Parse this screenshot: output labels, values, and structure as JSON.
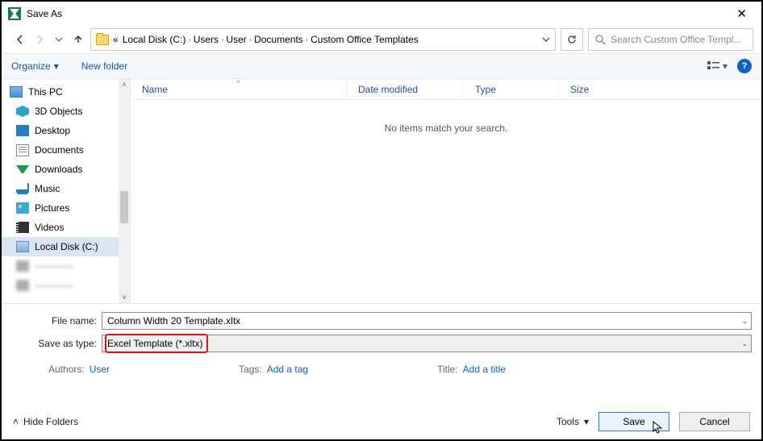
{
  "window": {
    "title": "Save As"
  },
  "address": {
    "prefix": "«",
    "crumbs": [
      "Local Disk (C:)",
      "Users",
      "User",
      "Documents",
      "Custom Office Templates"
    ],
    "search_placeholder": "Search Custom Office Templ..."
  },
  "toolbar": {
    "organize": "Organize",
    "newfolder": "New folder"
  },
  "tree": {
    "root": "This PC",
    "items": [
      "3D Objects",
      "Desktop",
      "Documents",
      "Downloads",
      "Music",
      "Pictures",
      "Videos",
      "Local Disk (C:)"
    ]
  },
  "columns": {
    "name": "Name",
    "date": "Date modified",
    "type": "Type",
    "size": "Size"
  },
  "listing": {
    "empty": "No items match your search."
  },
  "fields": {
    "filename_label": "File name:",
    "filename_value": "Column Width 20 Template.xltx",
    "savetype_label": "Save as type:",
    "savetype_value": "Excel Template (*.xltx)"
  },
  "meta": {
    "authors_label": "Authors:",
    "authors_value": "User",
    "tags_label": "Tags:",
    "tags_value": "Add a tag",
    "title_label": "Title:",
    "title_value": "Add a title"
  },
  "footer": {
    "hide": "Hide Folders",
    "tools": "Tools",
    "save": "Save",
    "cancel": "Cancel"
  }
}
